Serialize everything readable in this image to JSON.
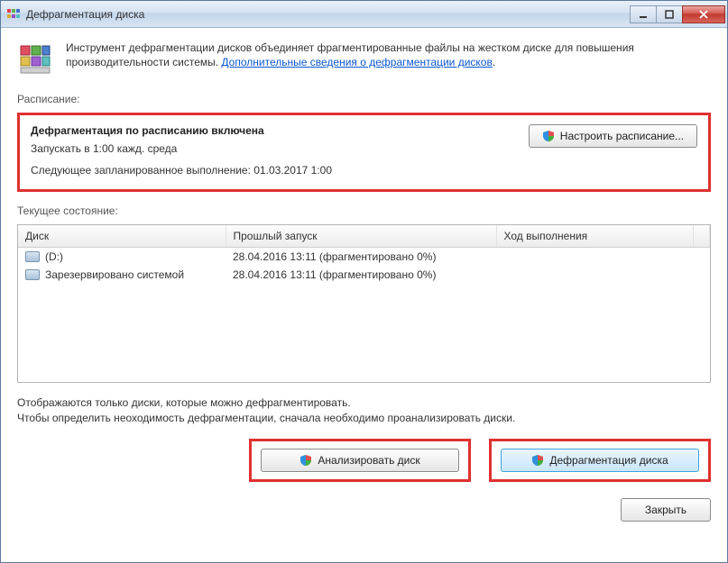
{
  "window": {
    "title": "Дефрагментация диска"
  },
  "intro": {
    "text_before_link": "Инструмент дефрагментации дисков объединяет фрагментированные файлы на жестком диске для повышения производительности системы. ",
    "link_text": "Дополнительные сведения о дефрагментации дисков",
    "link_suffix": "."
  },
  "schedule": {
    "section_label": "Расписание:",
    "title": "Дефрагментация по расписанию включена",
    "run_at": "Запускать в 1:00 кажд. среда",
    "next_run": "Следующее запланированное выполнение: 01.03.2017 1:00",
    "configure_button": "Настроить расписание..."
  },
  "status": {
    "section_label": "Текущее состояние:",
    "columns": {
      "disk": "Диск",
      "last_run": "Прошлый запуск",
      "progress": "Ход выполнения"
    },
    "rows": [
      {
        "disk": "(D:)",
        "last_run": "28.04.2016 13:11 (фрагментировано 0%)",
        "progress": ""
      },
      {
        "disk": "Зарезервировано системой",
        "last_run": "28.04.2016 13:11 (фрагментировано 0%)",
        "progress": ""
      }
    ]
  },
  "footer": {
    "line1": "Отображаются только диски, которые можно дефрагментировать.",
    "line2": "Чтобы определить неоходимость дефрагментации, сначала необходимо проанализировать диски."
  },
  "buttons": {
    "analyze": "Анализировать диск",
    "defrag": "Дефрагментация диска",
    "close": "Закрыть"
  }
}
